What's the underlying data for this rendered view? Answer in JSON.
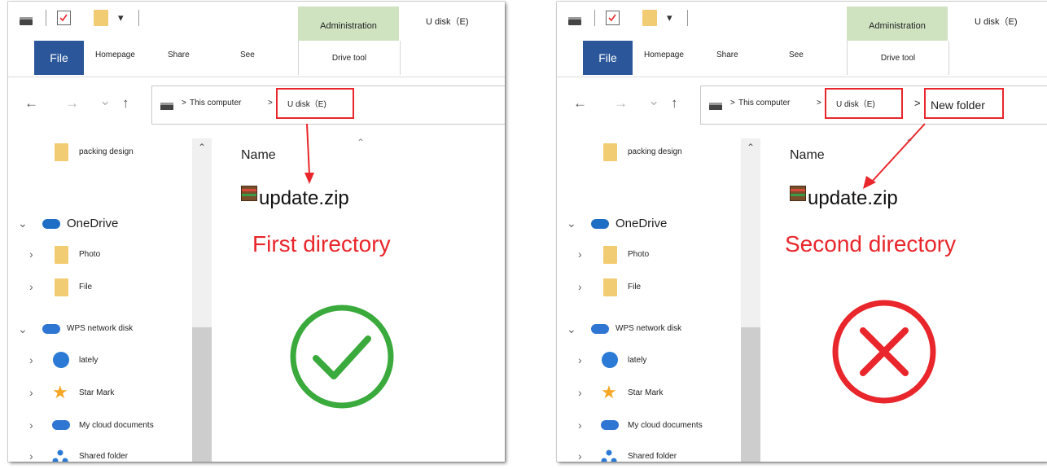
{
  "panels": [
    {
      "quick_access": {
        "icons": [
          "drive-icon",
          "checklist-icon",
          "folder-icon",
          "dropdown-icon"
        ]
      },
      "context_tab": "Administration",
      "window_title": "U disk（E)",
      "ribbon": {
        "file": "File",
        "tabs": [
          "Homepage",
          "Share",
          "See"
        ],
        "context_group": "Drive tool"
      },
      "nav": {
        "back": "←",
        "forward": "→",
        "recent": "⌄",
        "up": "↑"
      },
      "breadcrumb": [
        "This computer",
        "U disk（E)"
      ],
      "highlighted": "U disk（E)",
      "tree": [
        {
          "label": "packing design",
          "icon": "folder-icon"
        },
        {
          "label": "OneDrive",
          "icon": "onedrive-icon"
        },
        {
          "label": "Photo",
          "icon": "folder-icon"
        },
        {
          "label": "File",
          "icon": "folder-icon"
        },
        {
          "label": "WPS network disk",
          "icon": "wps-cloud-icon"
        },
        {
          "label": "lately",
          "icon": "clock-icon"
        },
        {
          "label": "Star Mark",
          "icon": "star-icon"
        },
        {
          "label": "My cloud documents",
          "icon": "cloud-docs-icon"
        },
        {
          "label": "Shared folder",
          "icon": "share-icon"
        }
      ],
      "column_header": "Name",
      "file": "update.zip",
      "caption": "First directory",
      "status": "correct",
      "status_color": "#3aaa3c"
    },
    {
      "quick_access": {
        "icons": [
          "drive-icon",
          "checklist-icon",
          "folder-icon",
          "dropdown-icon"
        ]
      },
      "context_tab": "Administration",
      "window_title": "U disk（E)",
      "ribbon": {
        "file": "File",
        "tabs": [
          "Homepage",
          "Share",
          "See"
        ],
        "context_group": "Drive tool"
      },
      "nav": {
        "back": "←",
        "forward": "→",
        "recent": "⌄",
        "up": "↑"
      },
      "breadcrumb": [
        "This computer",
        "U disk（E)",
        "New folder"
      ],
      "highlighted": "New folder",
      "tree": [
        {
          "label": "packing design",
          "icon": "folder-icon"
        },
        {
          "label": "OneDrive",
          "icon": "onedrive-icon"
        },
        {
          "label": "Photo",
          "icon": "folder-icon"
        },
        {
          "label": "File",
          "icon": "folder-icon"
        },
        {
          "label": "WPS network disk",
          "icon": "wps-cloud-icon"
        },
        {
          "label": "lately",
          "icon": "clock-icon"
        },
        {
          "label": "Star Mark",
          "icon": "star-icon"
        },
        {
          "label": "My cloud documents",
          "icon": "cloud-docs-icon"
        },
        {
          "label": "Shared folder",
          "icon": "share-icon"
        }
      ],
      "column_header": "Name",
      "file": "update.zip",
      "caption": "Second directory",
      "status": "wrong",
      "status_color": "#e8262b"
    }
  ],
  "colors": {
    "file_tab": "#2b579a",
    "admin_tab": "#cfe3c1",
    "highlight": "#e8262b",
    "folder": "#f2cc72"
  }
}
